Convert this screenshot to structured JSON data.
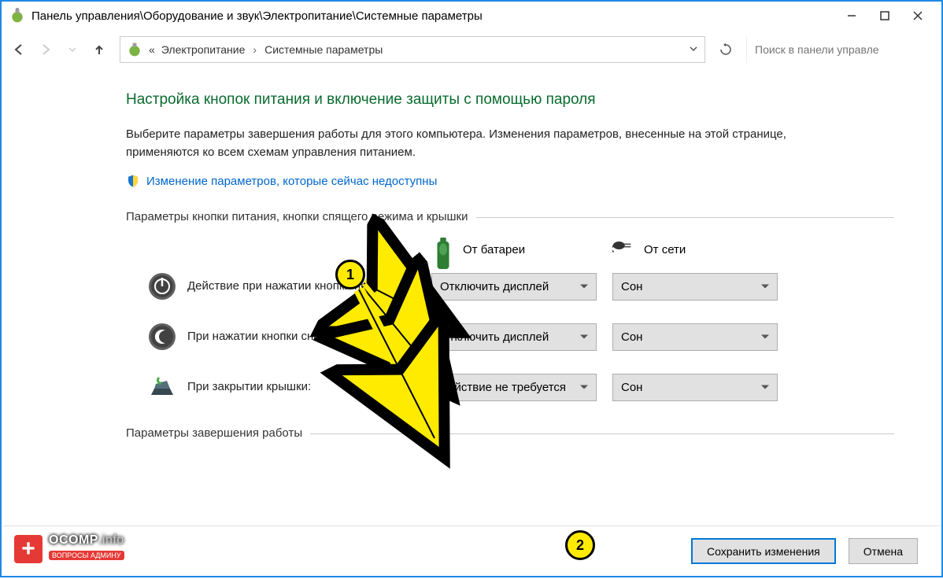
{
  "titlebar": {
    "path": "Панель управления\\Оборудование и звук\\Электропитание\\Системные параметры"
  },
  "breadcrumb": {
    "prefix": "«",
    "item1": "Электропитание",
    "item2": "Системные параметры"
  },
  "search": {
    "placeholder": "Поиск в панели управле"
  },
  "page": {
    "title": "Настройка кнопок питания и включение защиты с помощью пароля",
    "desc": "Выберите параметры завершения работы для этого компьютера. Изменения параметров, внесенные на этой странице, применяются ко всем схемам управления питанием.",
    "uac_link": "Изменение параметров, которые сейчас недоступны"
  },
  "section1": {
    "title": "Параметры кнопки питания, кнопки спящего режима и крышки"
  },
  "columns": {
    "battery": "От батареи",
    "plugged": "От сети"
  },
  "rows": [
    {
      "label": "Действие при нажатии кнопки питания:",
      "battery": "Отключить дисплей",
      "plugged": "Сон"
    },
    {
      "label": "При нажатии кнопки сна:",
      "battery": "Отключить дисплей",
      "plugged": "Сон"
    },
    {
      "label": "При закрытии крышки:",
      "battery": "Действие не требуется",
      "plugged": "Сон"
    }
  ],
  "section2": {
    "title": "Параметры завершения работы"
  },
  "footer": {
    "save": "Сохранить изменения",
    "cancel": "Отмена"
  },
  "annotations": {
    "marker1": "1",
    "marker2": "2"
  },
  "watermark": {
    "brand": "OCOMP",
    "suffix": ".info",
    "sub": "ВОПРОСЫ АДМИНУ"
  }
}
